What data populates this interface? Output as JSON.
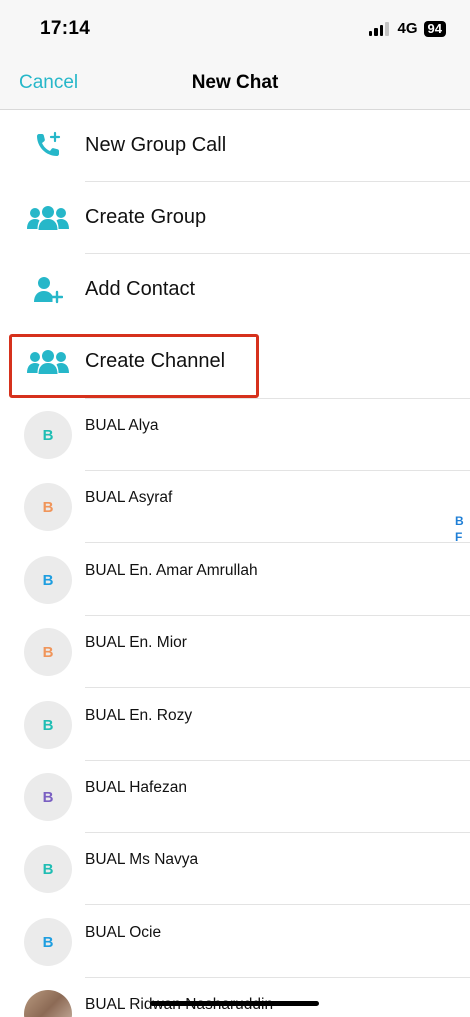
{
  "status": {
    "time": "17:14",
    "network": "4G",
    "battery": "94"
  },
  "nav": {
    "cancel": "Cancel",
    "title": "New Chat"
  },
  "actions": [
    {
      "label": "New Group Call",
      "icon": "phone-plus-icon"
    },
    {
      "label": "Create Group",
      "icon": "group-icon"
    },
    {
      "label": "Add Contact",
      "icon": "add-person-icon"
    },
    {
      "label": "Create Channel",
      "icon": "group-icon",
      "highlighted": true
    }
  ],
  "contacts": [
    {
      "initial": "B",
      "name": "BUAL Alya",
      "color": "#1fbdb3"
    },
    {
      "initial": "B",
      "name": "BUAL Asyraf",
      "color": "#f0955a"
    },
    {
      "initial": "B",
      "name": "BUAL En. Amar Amrullah",
      "color": "#1e9ee0"
    },
    {
      "initial": "B",
      "name": "BUAL En. Mior",
      "color": "#f0955a"
    },
    {
      "initial": "B",
      "name": "BUAL En. Rozy",
      "color": "#1fbdb3"
    },
    {
      "initial": "B",
      "name": "BUAL Hafezan",
      "color": "#7a5fc2"
    },
    {
      "initial": "B",
      "name": "BUAL Ms Navya",
      "color": "#1fbdb3"
    },
    {
      "initial": "B",
      "name": "BUAL Ocie",
      "color": "#1e9ee0"
    },
    {
      "initial": "",
      "name": "BUAL Ridwan Nasharuddin",
      "photo": true
    }
  ],
  "index": [
    "B",
    "F"
  ],
  "colors": {
    "accent": "#26b7c9",
    "highlight": "#d6311c",
    "index": "#1f7fd6"
  }
}
